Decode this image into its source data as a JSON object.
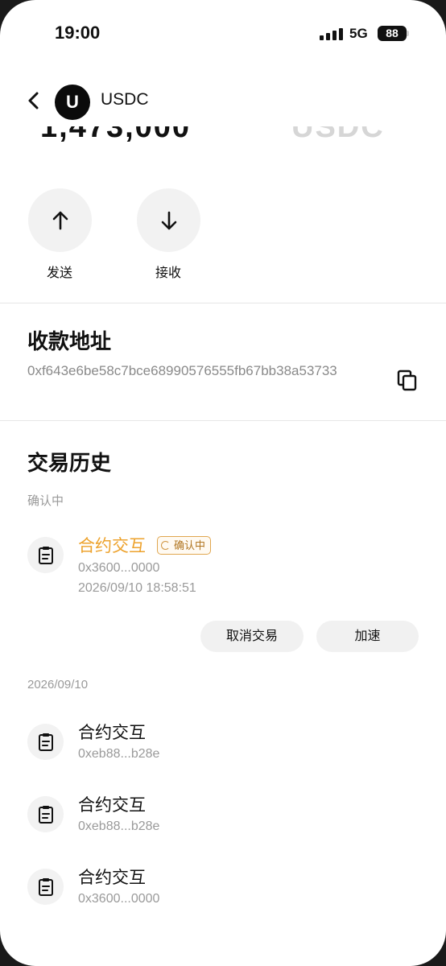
{
  "status_bar": {
    "time": "19:00",
    "network": "5G",
    "battery": "88"
  },
  "header": {
    "token_logo_letter": "U",
    "token_name": "USDC"
  },
  "balance_partial": {
    "amount": "1,473,000",
    "unit": "USDC"
  },
  "actions": [
    {
      "label": "发送",
      "icon": "arrow-up-icon"
    },
    {
      "label": "接收",
      "icon": "arrow-down-icon"
    }
  ],
  "receive_address": {
    "title": "收款地址",
    "address": "0xf643e6be58c7bce68990576555fb67bb38a53733",
    "copy_icon": "copy-icon"
  },
  "history": {
    "title": "交易历史",
    "pending_group": {
      "label": "确认中",
      "item": {
        "title": "合约交互",
        "status_badge": "确认中",
        "hash": "0x3600...0000",
        "time": "2026/09/10 18:58:51"
      },
      "buttons": {
        "cancel": "取消交易",
        "speed_up": "加速"
      }
    },
    "date_group": {
      "label": "2026/09/10",
      "items": [
        {
          "title": "合约交互",
          "hash": "0xeb88...b28e"
        },
        {
          "title": "合约交互",
          "hash": "0xeb88...b28e"
        },
        {
          "title": "合约交互",
          "hash": "0x3600...0000"
        }
      ]
    }
  },
  "colors": {
    "pending": "#eda22c",
    "muted_text": "#9a9a9a",
    "chip_bg": "#f2f2f2"
  }
}
